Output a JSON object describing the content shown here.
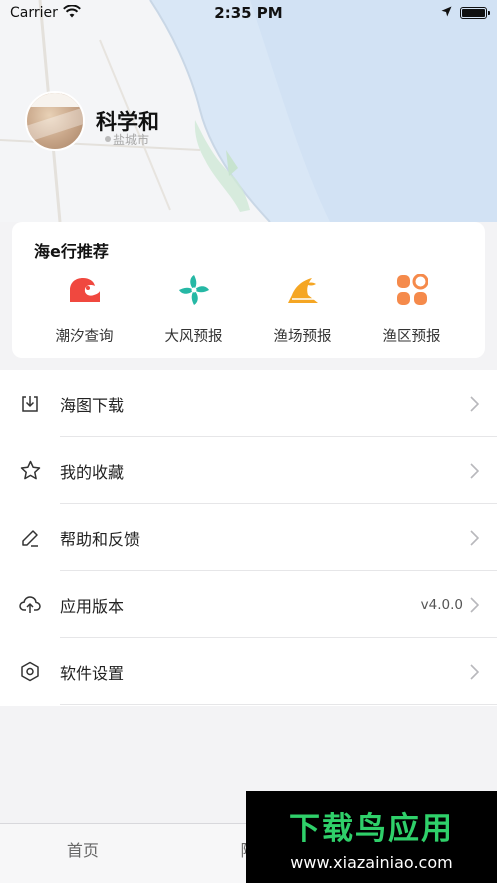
{
  "status_bar": {
    "carrier": "Carrier",
    "time": "2:35 PM"
  },
  "profile": {
    "user_name": "科学和",
    "map_label": "盐城市"
  },
  "recommend": {
    "title": "海e行推荐",
    "items": [
      {
        "label": "潮汐查询",
        "icon": "tide-wave-icon",
        "color": "#f0483f"
      },
      {
        "label": "大风预报",
        "icon": "windmill-icon",
        "color": "#26b8a5"
      },
      {
        "label": "渔场预报",
        "icon": "fishing-ground-icon",
        "color": "#f5a623"
      },
      {
        "label": "渔区预报",
        "icon": "grid-squares-icon",
        "color": "#f58a4b"
      }
    ]
  },
  "menu": [
    {
      "label": "海图下载",
      "icon": "download-icon",
      "value": ""
    },
    {
      "label": "我的收藏",
      "icon": "star-icon",
      "value": ""
    },
    {
      "label": "帮助和反馈",
      "icon": "edit-pencil-icon",
      "value": ""
    },
    {
      "label": "应用版本",
      "icon": "cloud-upload-icon",
      "value": "v4.0.0"
    },
    {
      "label": "软件设置",
      "icon": "hexagon-settings-icon",
      "value": ""
    }
  ],
  "tab_bar": {
    "tabs": [
      {
        "label": "首页"
      },
      {
        "label": "附"
      },
      {
        "label": ""
      }
    ]
  },
  "watermark": {
    "title": "下载鸟应用",
    "url": "www.xiazainiao.com"
  }
}
